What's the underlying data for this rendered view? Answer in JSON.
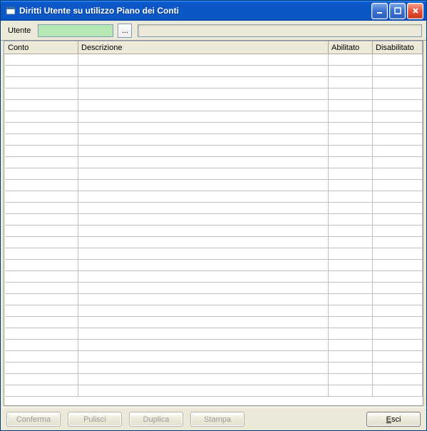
{
  "titlebar": {
    "title": "Diritti Utente su utilizzo Piano dei Conti"
  },
  "toolbar": {
    "utente_label": "Utente",
    "utente_value": "",
    "browse_label": "...",
    "desc_value": ""
  },
  "table": {
    "columns": {
      "conto": "Conto",
      "descrizione": "Descrizione",
      "abilitato": "Abilitato",
      "disabilitato": "Disabilitato"
    },
    "row_count": 30,
    "rows": []
  },
  "buttons": {
    "conferma": "Conferma",
    "pulisci": "Pulisci",
    "duplica": "Duplica",
    "stampa": "Stampa",
    "esci_prefix": "E",
    "esci_rest": "sci"
  }
}
